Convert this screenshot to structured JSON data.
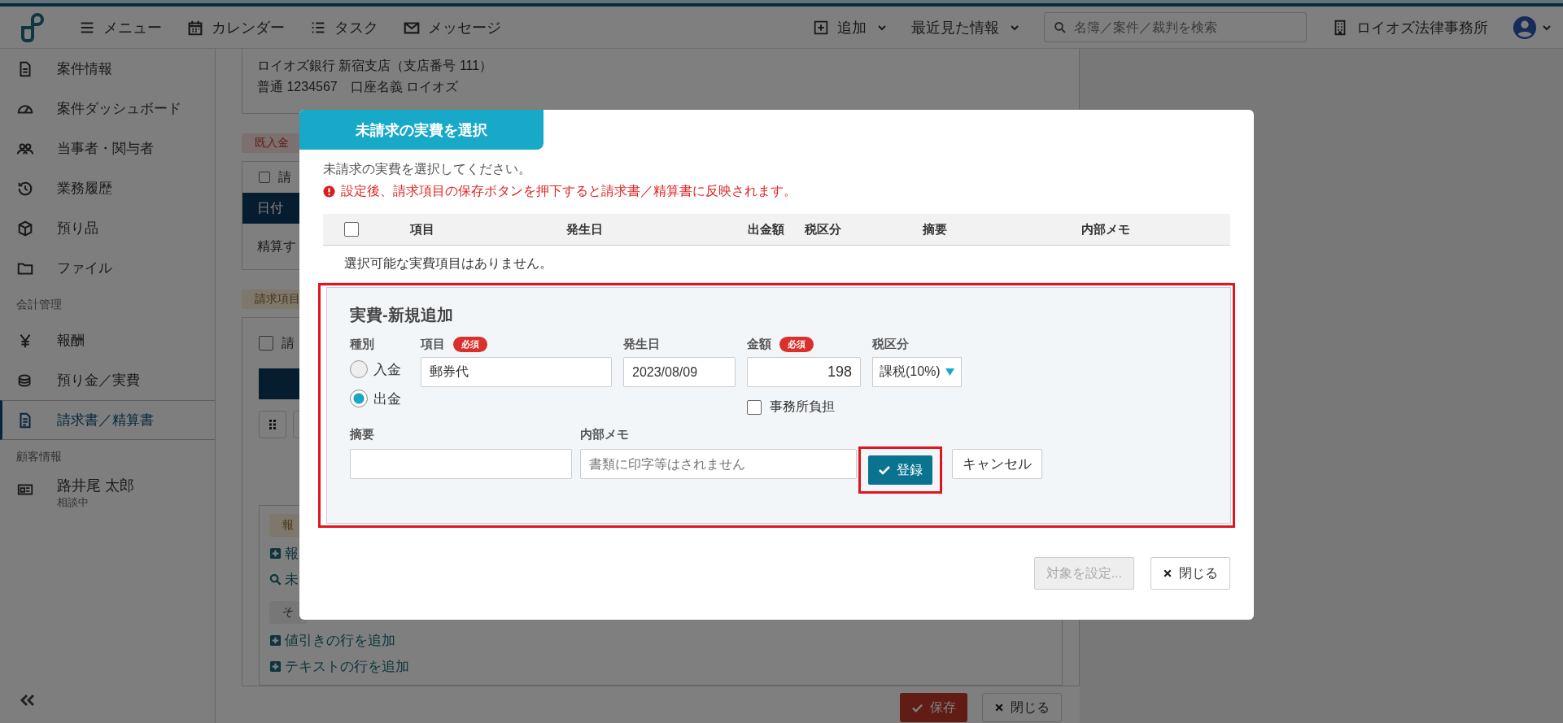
{
  "topbar": {
    "nav": [
      {
        "label": "メニュー"
      },
      {
        "label": "カレンダー"
      },
      {
        "label": "タスク"
      },
      {
        "label": "メッセージ"
      }
    ],
    "add": "追加",
    "recent": "最近見た情報",
    "search": {
      "placeholder": "名簿／案件／裁判を検索"
    },
    "office": "ロイオズ法律事務所"
  },
  "sidebar": {
    "case_items": [
      {
        "label": "案件情報",
        "selected": false
      },
      {
        "label": "案件ダッシュボード",
        "selected": false
      },
      {
        "label": "当事者・関与者",
        "selected": false
      },
      {
        "label": "業務履歴",
        "selected": false
      },
      {
        "label": "預り品",
        "selected": false
      },
      {
        "label": "ファイル",
        "selected": false
      }
    ],
    "accounting_heading": "会計管理",
    "accounting_items": [
      {
        "label": "報酬",
        "selected": false
      },
      {
        "label": "預り金／実費",
        "selected": false
      },
      {
        "label": "請求書／精算書",
        "selected": true
      }
    ],
    "customer_heading": "顧客情報",
    "client": {
      "name": "路井尾 太郎",
      "status": "相談中"
    }
  },
  "background": {
    "bank_lines": [
      "ロイオズ銀行 新宿支店（支店番号 111）",
      "普通 1234567　口座名義 ロイオズ"
    ],
    "deposit_badge": "既入金",
    "deposit_card": {
      "check_label": "請",
      "checked": false,
      "header": "日付",
      "row": "精算す"
    },
    "billing_badge": "請求項目",
    "billing_card": {
      "check_label": "請",
      "checked": false
    },
    "fee_badge": "報",
    "links": [
      {
        "kind": "add",
        "label": "報"
      },
      {
        "kind": "search",
        "label": "未"
      }
    ],
    "other_badge": "そ",
    "add_links": [
      {
        "kind": "add",
        "label": "値引きの行を追加"
      },
      {
        "kind": "add",
        "label": "テキストの行を追加"
      }
    ],
    "save": "保存",
    "close": "閉じる"
  },
  "modal": {
    "title": "未請求の実費を選択",
    "instruction": "未請求の実費を選択してください。",
    "warning": "設定後、請求項目の保存ボタンを押下すると請求書／精算書に反映されます。",
    "table": {
      "select_all": false,
      "columns": [
        "項目",
        "発生日",
        "出金額",
        "税区分",
        "摘要",
        "内部メモ"
      ],
      "empty": "選択可能な実費項目はありません。"
    },
    "form": {
      "title": "実費-新規追加",
      "type_label": "種別",
      "types": [
        {
          "label": "入金",
          "selected": false
        },
        {
          "label": "出金",
          "selected": true
        }
      ],
      "item": {
        "label": "項目",
        "required": "必須",
        "value": "郵券代"
      },
      "date": {
        "label": "発生日",
        "value": "2023/08/09"
      },
      "amount": {
        "label": "金額",
        "required": "必須",
        "value": "198"
      },
      "tax": {
        "label": "税区分",
        "value": "課税(10%)"
      },
      "office_burden": {
        "label": "事務所負担",
        "checked": false
      },
      "summary": {
        "label": "摘要"
      },
      "memo": {
        "label": "内部メモ",
        "placeholder": "書類に印字等はされません"
      },
      "register": "登録",
      "cancel": "キャンセル"
    },
    "set_target": {
      "label": "対象を設定...",
      "disabled": true
    },
    "close": "閉じる"
  }
}
